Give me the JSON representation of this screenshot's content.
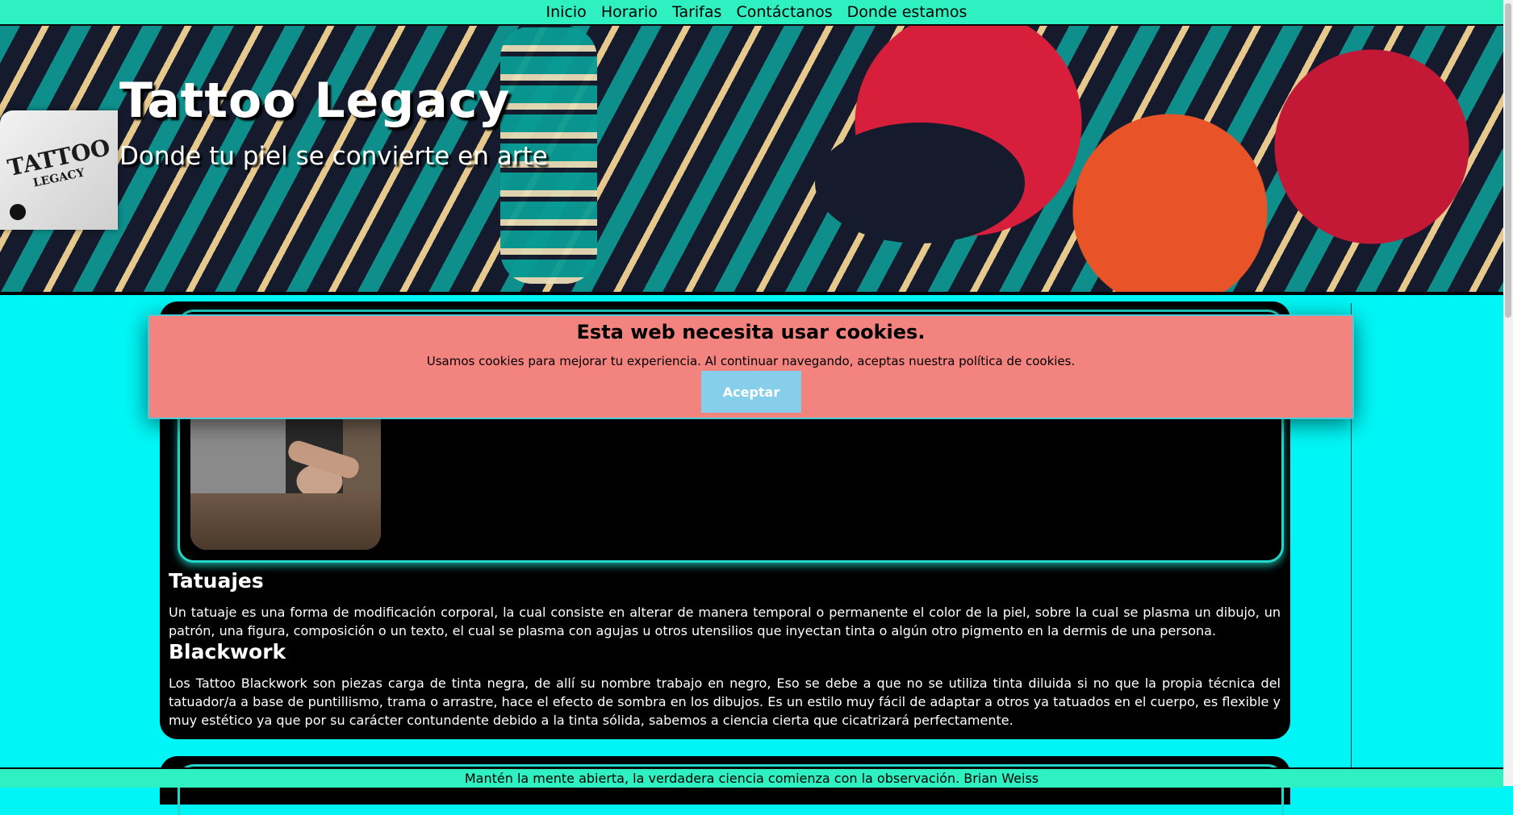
{
  "nav": {
    "items": [
      "Inicio",
      "Horario",
      "Tarifas",
      "Contáctanos",
      "Donde estamos"
    ]
  },
  "header": {
    "title": "Tattoo Legacy",
    "subtitle": "Donde tu piel se convierte en arte",
    "logo_text": "TATTOO",
    "logo_sub": "LEGACY"
  },
  "main": {
    "sections": [
      {
        "heading": "Tatuajes",
        "text": "Un tatuaje es una forma de modificación corporal, la cual consiste en alterar de manera temporal o permanente el color de la piel, sobre la cual se plasma un dibujo, un patrón, una figura, composición o un texto, el cual se plasma con agujas u otros utensilios que inyectan tinta o algún otro pigmento en la dermis de una persona."
      },
      {
        "heading": "Blackwork",
        "text": "Los Tattoo Blackwork son piezas carga de tinta negra, de allí su nombre trabajo en negro, Eso se debe a que no se utiliza tinta diluida si no que la propia técnica del tatuador/a a base de puntillismo, trama o arrastre, hace el efecto de sombra en los dibujos. Es un estilo muy fácil de adaptar a otros ya tatuados en el cuerpo, es flexible y muy estético ya que por su carácter contundente debido a la tinta sólida, sabemos a ciencia cierta que cicatrizará perfectamente."
      }
    ]
  },
  "cookie": {
    "title": "Esta web necesita usar cookies.",
    "text": "Usamos cookies para mejorar tu experiencia. Al continuar navegando, aceptas nuestra política de cookies.",
    "button": "Aceptar"
  },
  "footer": {
    "quote": "Mantén la mente abierta, la verdadera ciencia comienza con la observación. Brian Weiss"
  },
  "colors": {
    "nav_bg": "#2ef0c0",
    "page_bg": "#00f6f6",
    "cookie_bg": "#f2837e",
    "cookie_button": "#87ceeb",
    "card_border": "#23d6c9"
  }
}
